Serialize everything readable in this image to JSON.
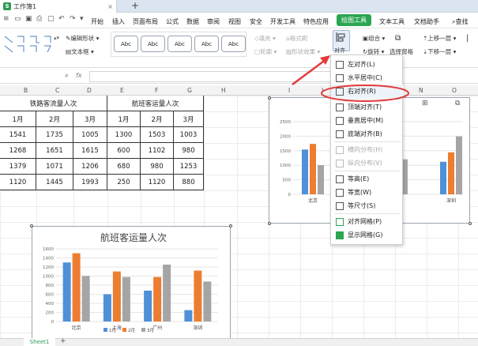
{
  "title_bar": {
    "app_tab": "工作簿1",
    "new_tab": "+",
    "app_icon": "S"
  },
  "menu": {
    "items": [
      "开始",
      "插入",
      "页面布局",
      "公式",
      "数据",
      "审阅",
      "视图",
      "安全",
      "开发工具",
      "特色应用",
      "绘图工具",
      "文本工具",
      "文档助手"
    ],
    "active": "绘图工具",
    "search": "查找"
  },
  "ribbon": {
    "edit_shape": "编辑形状",
    "text_box": "文本框",
    "shape_styles": [
      "Abc",
      "Abc",
      "Abc",
      "Abc",
      "Abc"
    ],
    "fill": "填充",
    "format_brush": "格式刷",
    "outline": "轮廓",
    "shape_effect": "形状效果",
    "align": "对齐",
    "group": "组合",
    "rotate": "旋转",
    "selection_pane": "选择窗格",
    "bring_forward": "上移一层",
    "send_backward": "下移一层"
  },
  "formula_bar": {
    "fx": "fx"
  },
  "columns": [
    "B",
    "C",
    "D",
    "E",
    "F",
    "G",
    "H",
    "I",
    "J",
    "N",
    "O"
  ],
  "table": {
    "group_headers": [
      "铁路客流量人次",
      "航班客运量人次"
    ],
    "month_headers": [
      "1月",
      "2月",
      "3月",
      "1月",
      "2月",
      "3月"
    ],
    "rows": [
      [
        "1541",
        "1735",
        "1005",
        "1300",
        "1503",
        "1003"
      ],
      [
        "1268",
        "1651",
        "1615",
        "600",
        "1102",
        "980"
      ],
      [
        "1379",
        "1071",
        "1206",
        "680",
        "980",
        "1253"
      ],
      [
        "1120",
        "1445",
        "1993",
        "250",
        "1120",
        "880"
      ]
    ]
  },
  "dropdown": {
    "items": [
      {
        "label": "左对齐(L)",
        "enabled": true
      },
      {
        "label": "水平居中(C)",
        "enabled": true
      },
      {
        "label": "右对齐(R)",
        "enabled": true
      },
      {
        "label": "顶端对齐(T)",
        "enabled": true
      },
      {
        "label": "垂直居中(M)",
        "enabled": true
      },
      {
        "label": "底端对齐(B)",
        "enabled": true
      },
      {
        "label": "横向分布(H)",
        "enabled": false
      },
      {
        "label": "纵向分布(V)",
        "enabled": false
      },
      {
        "label": "等高(E)",
        "enabled": true
      },
      {
        "label": "等宽(W)",
        "enabled": true
      },
      {
        "label": "等尺寸(S)",
        "enabled": true
      },
      {
        "label": "对齐网格(P)",
        "enabled": true
      },
      {
        "label": "显示网格(G)",
        "enabled": true
      }
    ],
    "highlighted": "右对齐(R)"
  },
  "chart_data": [
    {
      "type": "bar",
      "title": "航班客运量人次",
      "categories": [
        "北京",
        "上海",
        "广州",
        "深圳"
      ],
      "series": [
        {
          "name": "1月",
          "values": [
            1300,
            600,
            680,
            250
          ]
        },
        {
          "name": "2月",
          "values": [
            1503,
            1102,
            980,
            1120
          ]
        },
        {
          "name": "3月",
          "values": [
            1003,
            980,
            1253,
            880
          ]
        }
      ],
      "ylim": [
        0,
        1600
      ],
      "yticks": [
        "0",
        "200",
        "400",
        "600",
        "800",
        "1000",
        "1200",
        "1400",
        "1600"
      ],
      "legend": "bottom"
    },
    {
      "type": "bar",
      "title": "",
      "categories": [
        "北京",
        "深圳"
      ],
      "series": [
        {
          "name": "1月",
          "values": [
            1541,
            1120
          ]
        },
        {
          "name": "2月",
          "values": [
            1735,
            1445
          ]
        },
        {
          "name": "3月",
          "values": [
            1005,
            1993
          ]
        }
      ],
      "ylim": [
        0,
        2500
      ],
      "yticks": [
        "0",
        "500",
        "1000",
        "1500",
        "2000",
        "2500"
      ],
      "partial_third_group_value": 1206
    }
  ],
  "colors": {
    "s1": "#4f90d8",
    "s2": "#ed7d31",
    "s3": "#a5a5a5",
    "accent": "#2aa652",
    "annotation": "#e23b3b"
  },
  "sheet": {
    "tab": "Sheet1",
    "add": "+"
  }
}
